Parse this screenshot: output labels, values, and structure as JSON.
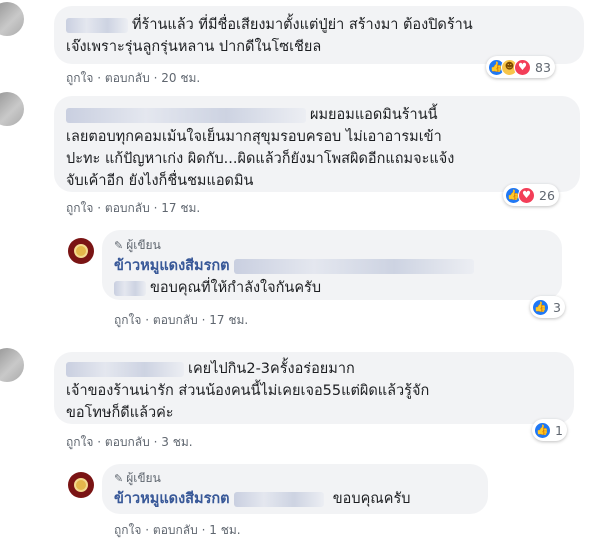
{
  "comments": [
    {
      "lines": [
        "ที่ร้านแล้ว ที่มีชื่อเสียงมาตั้งแต่ปู่ย่า สร้างมา ต้องปิดร้าน",
        "เจ๊งเพราะรุ่นลูกรุ่นหลาน ปากดีในโซเชียล"
      ],
      "actions": {
        "like": "ถูกใจ",
        "reply": "ตอบกลับ",
        "time": "20 ชม."
      },
      "reaction_count": "83"
    },
    {
      "lines": [
        "ผมยอมแอดมินร้านนี้",
        "เลยตอบทุกคอมเม้นใจเย็นมากสุขุมรอบครอบ ไม่เอาอารมเข้า",
        "ปะทะ แก้ปัญหาเก่ง ผิดกับ...ผิดแล้วก็ยังมาโพสผิดอีกแถมจะแจ้ง",
        "จับเค้าอีก ยังไงก็ชื่นชมแอดมิน"
      ],
      "actions": {
        "like": "ถูกใจ",
        "reply": "ตอบกลับ",
        "time": "17 ชม."
      },
      "reaction_count": "26"
    },
    {
      "lines": [
        "เคยไปกิน2-3ครั้งอร่อยมาก",
        "เจ้าของร้านน่ารัก ส่วนน้องคนนี้ไม่เคยเจอ55แต่ผิดแล้วรู้จัก",
        "ขอโทษก็ดีแล้วค่ะ"
      ],
      "actions": {
        "like": "ถูกใจ",
        "reply": "ตอบกลับ",
        "time": "3 ชม."
      },
      "reaction_count": "1"
    }
  ],
  "replies": [
    {
      "author_tag": "ผู้เขียน",
      "page_name": "ข้าวหมูแดงสีมรกต",
      "text": "ขอบคุณที่ให้กำลังใจกันครับ",
      "actions": {
        "like": "ถูกใจ",
        "reply": "ตอบกลับ",
        "time": "17 ชม."
      },
      "reaction_count": "3"
    },
    {
      "author_tag": "ผู้เขียน",
      "page_name": "ข้าวหมูแดงสีมรกต",
      "text": "ขอบคุณครับ",
      "actions": {
        "like": "ถูกใจ",
        "reply": "ตอบกลับ",
        "time": "1 ชม."
      }
    }
  ],
  "separator": "·",
  "icons": {
    "like": "like-icon",
    "haha": "haha-icon",
    "love": "love-icon",
    "author": "pencil-icon"
  },
  "colors": {
    "bubble": "#f2f3f5",
    "link": "#385898",
    "like_blue": "#2078f4",
    "love_red": "#f33e58",
    "meta": "#606770"
  }
}
